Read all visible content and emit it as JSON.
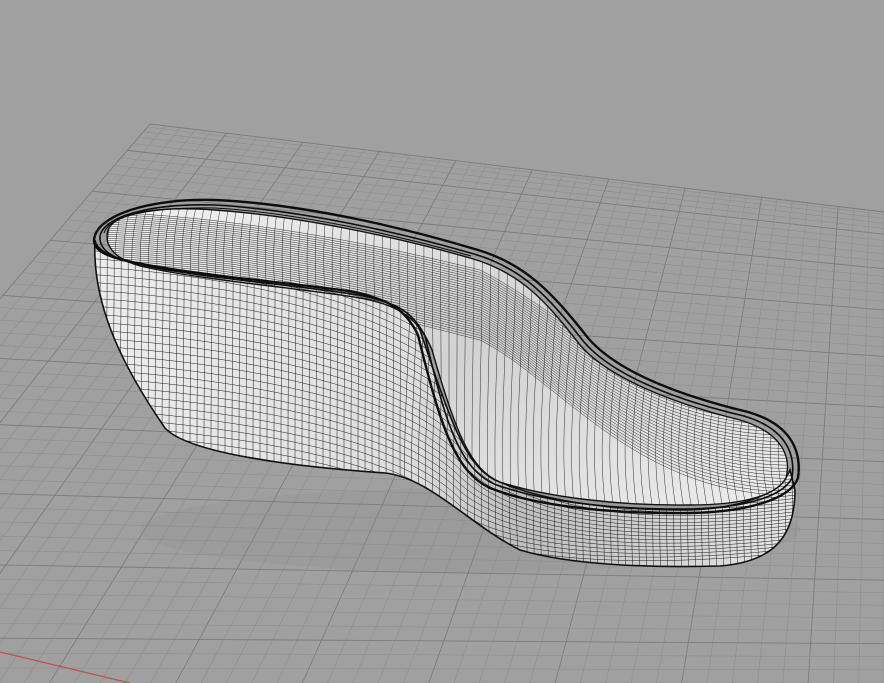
{
  "viewport": {
    "view_type": "perspective",
    "display_mode": "wireframe-shaded",
    "background_color": "#a0a0a0",
    "grid_visible": true,
    "grid_line_color": "#8e8e8e",
    "grid_major_line_color": "#7b7b7b",
    "x_axis_color": "#c0504d"
  },
  "model": {
    "object": "shoe-sole-wedge-surface",
    "surface_color": "#e4e4e4",
    "shadow_color": "#8c8c8c",
    "isocurve_color": "#1a1a1a"
  }
}
